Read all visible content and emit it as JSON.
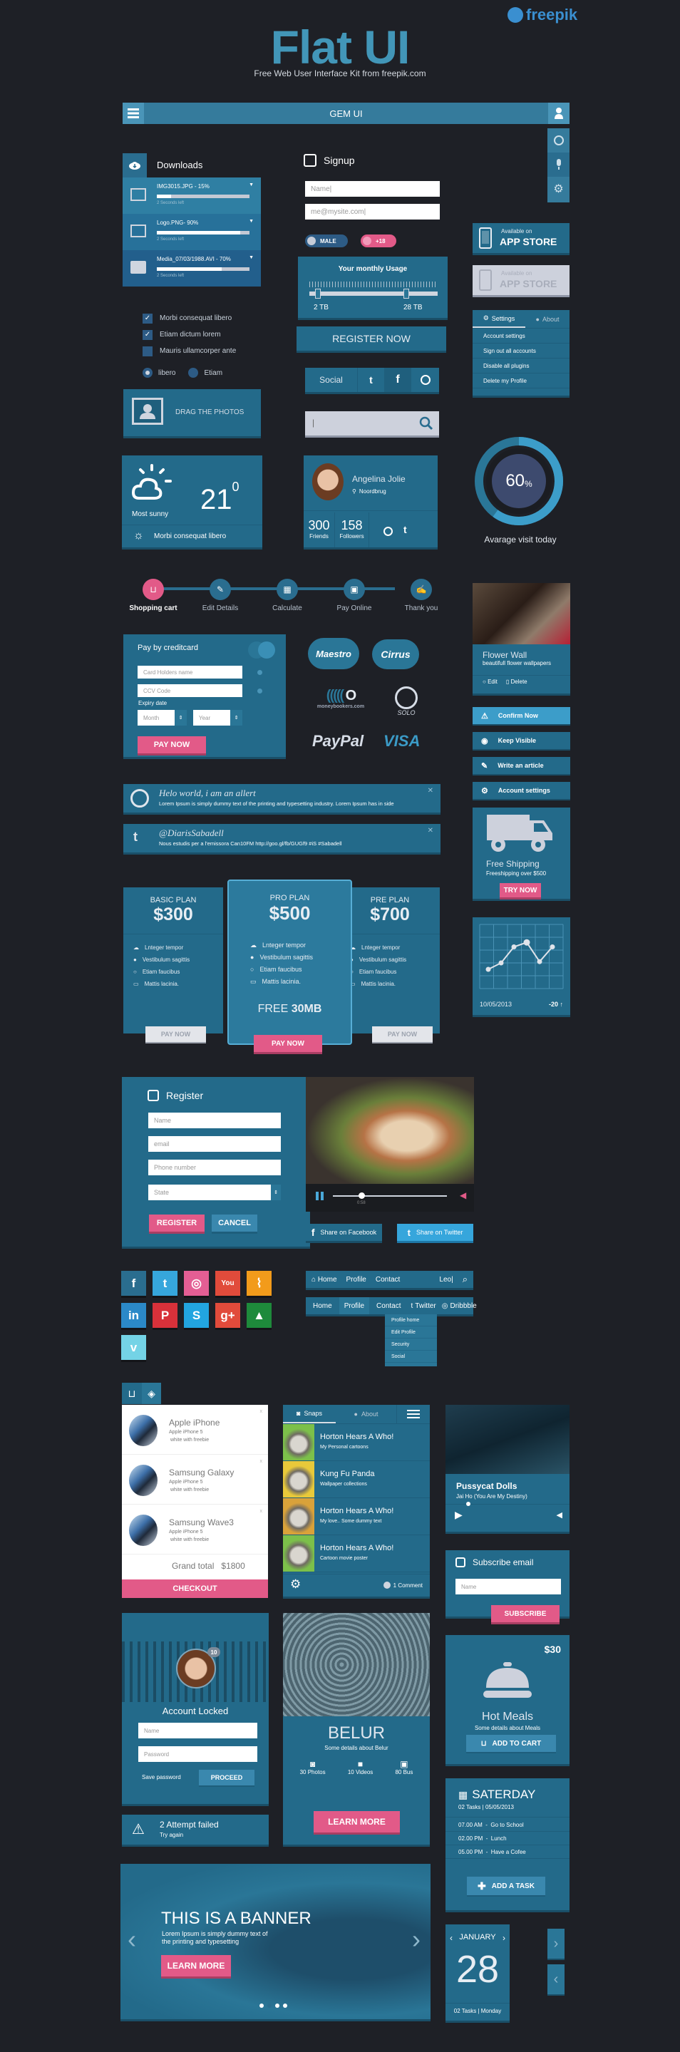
{
  "header": {
    "title": "Flat UI",
    "subtitle": "Free Web User Interface Kit from freepik.com",
    "brand": "freepik"
  },
  "topbar": {
    "title": "GEM UI"
  },
  "downloads": {
    "title": "Downloads",
    "items": [
      {
        "name": "IMG3015.JPG - 15%",
        "progress": 0.15,
        "status": "2 Seconds left",
        "type": "image"
      },
      {
        "name": "Logo.PNG- 90%",
        "progress": 0.9,
        "status": "2 Seconds left",
        "type": "image"
      },
      {
        "name": "Media_07/03/1988.AVI - 70%",
        "progress": 0.7,
        "status": "2 Seconds left",
        "type": "video"
      }
    ]
  },
  "checkboxes": [
    {
      "label": "Morbi consequat libero",
      "checked": true
    },
    {
      "label": "Etiam dictum lorem",
      "checked": true
    },
    {
      "label": "Mauris ullamcorper ante",
      "checked": false
    }
  ],
  "radios": [
    {
      "label": "libero",
      "selected": true
    },
    {
      "label": "Etiam",
      "selected": false
    }
  ],
  "drag": {
    "label": "DRAG  THE PHOTOS"
  },
  "signup": {
    "title": "Signup",
    "name_value": "Name|",
    "email_value": "me@mysite.com|",
    "toggle_male": "MALE",
    "toggle_18": "+18",
    "usage_title": "Your monthly Usage",
    "usage_min": "2 TB",
    "usage_max": "28 TB",
    "register": "REGISTER NOW",
    "social": "Social",
    "search_value": "|"
  },
  "appstore": [
    {
      "small": "Available on",
      "big": "APP STORE",
      "enabled": true
    },
    {
      "small": "Available on",
      "big": "APP STORE",
      "enabled": false
    }
  ],
  "settings_menu": {
    "tabs": [
      "Settings",
      "About"
    ],
    "items": [
      "Account settings",
      "Sign out all accounts",
      "Disable all plugins",
      "Delete my Profile"
    ]
  },
  "weather": {
    "condition": "Most sunny",
    "temp": "21",
    "unit": "0",
    "footer": "Morbi consequat libero"
  },
  "profile": {
    "name": "Angelina Jolie",
    "location": "Noordbrug",
    "friends": "300",
    "friends_label": "Friends",
    "followers": "158",
    "followers_label": "Followers"
  },
  "gauge": {
    "value": 60,
    "label_value": "60",
    "label_unit": "%",
    "caption": "Avarage visit today"
  },
  "steps": [
    "Shopping cart",
    "Edit Details",
    "Calculate",
    "Pay Online",
    "Thank you"
  ],
  "flower_card": {
    "title": "Flower Wall",
    "subtitle": "beautifull flower wallpapers",
    "edit": "Edit",
    "delete": "Delete"
  },
  "payment": {
    "title": "Pay by creditcard",
    "card_placeholder": "Card Holders name",
    "ccv_placeholder": "CCV Code",
    "expiry_label": "Expiry date",
    "month": "Month",
    "year": "Year",
    "pay": "PAY NOW",
    "logos": [
      "Maestro",
      "Cirrus",
      "moneybookers.com",
      "SOLO",
      "PayPal",
      "VISA"
    ]
  },
  "action_buttons": [
    "Confirm Now",
    "Keep Visible",
    "Write an article",
    "Account settings"
  ],
  "alerts": [
    {
      "title": "Helo world, i am an allert",
      "text": "Lorem Ipsum is simply dummy text of the printing and typesetting industry. Lorem Ipsum has in side"
    },
    {
      "title": "@DiarisSabadell",
      "text": "Nous estudis per a l'emissora Can10FM http://goo.gl/fb/GUGf9  #iS #Sabadell"
    }
  ],
  "shipping": {
    "title": "Free Shipping",
    "subtitle": "Freeshipping over $500",
    "button": "TRY NOW"
  },
  "pricing": {
    "features": [
      "Lnteger tempor",
      "Vestibulum sagittis",
      "Etiam faucibus",
      "Mattis lacinia."
    ],
    "plans": [
      {
        "name": "BASIC PLAN",
        "price": "$300",
        "button": "PAY NOW"
      },
      {
        "name": "PRO PLAN",
        "price": "$500",
        "extra_a": "FREE",
        "extra_b": "30MB",
        "button": "PAY NOW"
      },
      {
        "name": "PRE PLAN",
        "price": "$700",
        "button": "PAY NOW"
      }
    ]
  },
  "line_chart": {
    "date": "10/05/2013",
    "delta": "-20"
  },
  "chart_data": {
    "type": "line",
    "title": "",
    "x": [
      1,
      2,
      3,
      4,
      5,
      6
    ],
    "values": [
      3,
      4,
      6.5,
      7.2,
      4.2,
      6.5
    ],
    "ylim": [
      0,
      10
    ],
    "grid": true,
    "footer_left": "10/05/2013",
    "footer_right": "-20"
  },
  "register": {
    "title": "Register",
    "fields": [
      "Name",
      "email",
      "Phone number",
      "State"
    ],
    "register": "REGISTER",
    "cancel": "CANCEL"
  },
  "video": {
    "time": "0:58",
    "progress": 0.25,
    "share_fb": "Share on Facebook",
    "share_tw": "Share on Twitter"
  },
  "social_tiles": [
    {
      "name": "facebook",
      "glyph": "f",
      "color": "#2a6d8f"
    },
    {
      "name": "twitter",
      "glyph": "t",
      "color": "#36a6dc"
    },
    {
      "name": "dribbble",
      "glyph": "◎",
      "color": "#e45e94"
    },
    {
      "name": "youtube",
      "glyph": "You",
      "color": "#e14b3b"
    },
    {
      "name": "rss",
      "glyph": "⌇",
      "color": "#f29b1b"
    },
    {
      "name": "linkedin",
      "glyph": "in",
      "color": "#2b89c8"
    },
    {
      "name": "pinterest",
      "glyph": "P",
      "color": "#d8313a"
    },
    {
      "name": "skype",
      "glyph": "S",
      "color": "#22a5e0"
    },
    {
      "name": "googleplus",
      "glyph": "g+",
      "color": "#e14b3b"
    },
    {
      "name": "forrst",
      "glyph": "▲",
      "color": "#1e8a3b"
    },
    {
      "name": "vimeo",
      "glyph": "v",
      "color": "#74d3e6"
    }
  ],
  "nav1": {
    "items": [
      "Home",
      "Profile",
      "Contact"
    ],
    "search_value": "Leo|"
  },
  "nav2": {
    "items": [
      "Home",
      "Profile",
      "Contact"
    ],
    "right": [
      "Twitter",
      "Dribbble"
    ],
    "dropdown": [
      "Profile home",
      "Edit Profile",
      "Security",
      "Social"
    ]
  },
  "cart": {
    "items": [
      {
        "title": "Apple iPhone",
        "line1": "Apple iPhone 5",
        "line2": "white with freebie"
      },
      {
        "title": "Samsung Galaxy",
        "line1": "Apple iPhone 5",
        "line2": "white with freebie"
      },
      {
        "title": "Samsung Wave3",
        "line1": "Apple iPhone 5",
        "line2": "white with freebie"
      }
    ],
    "total_label": "Grand total",
    "total": "$1800",
    "checkout": "CHECKOUT"
  },
  "snaps": {
    "tabs": [
      "Snaps",
      "About"
    ],
    "items": [
      {
        "title": "Horton Hears A Who!",
        "sub": "My Personal cartoons",
        "color": "#7cc04a"
      },
      {
        "title": "Kung Fu Panda",
        "sub": "Wallpaper collections",
        "color": "#e8c93a"
      },
      {
        "title": "Horton Hears A Who!",
        "sub": "My love.. Some dummy text",
        "color": "#d9a23a"
      },
      {
        "title": "Horton Hears A Who!",
        "sub": "Cartoon movie poster",
        "color": "#7cc04a"
      }
    ],
    "comments": "1 Comment"
  },
  "music": {
    "artist": "Pussycat Dolls",
    "song": "Jai Ho (You Are My Destiny)",
    "progress": 0.1
  },
  "subscribe": {
    "title": "Subscribe email",
    "placeholder": "Name",
    "button": "SUBSCRIBE"
  },
  "meals": {
    "price": "$30",
    "title": "Hot Meals",
    "subtitle": "Some details about Meals",
    "button": "ADD TO CART"
  },
  "locked": {
    "badge": "10",
    "title": "Account Locked",
    "name": "Name",
    "password": "Password",
    "save": "Save password",
    "proceed": "PROCEED"
  },
  "attempt": {
    "title": "2 Attempt failed",
    "sub": "Try again"
  },
  "belur": {
    "title": "BELUR",
    "sub": "Some details about Belur",
    "stats": [
      "30 Photos",
      "10 Videos",
      "80 Bus"
    ],
    "button": "LEARN MORE"
  },
  "tasks": {
    "day": "SATERDAY",
    "meta": "02 Tasks | 05/05/2013",
    "items": [
      "07.00 AM  -  Go to School",
      "02.00 PM  -  Lunch",
      "05.00 PM  -  Have a Cofee"
    ],
    "button": "ADD A TASK"
  },
  "banner": {
    "title": "THIS IS A BANNER",
    "text1": "Lorem Ipsum is simply dummy text of",
    "text2": "the printing and typesetting",
    "button": "LEARN MORE",
    "dots": 4,
    "active_dot": 1
  },
  "calendar": {
    "month": "JANUARY",
    "day": "28",
    "footer": "02 Tasks |  Monday"
  }
}
